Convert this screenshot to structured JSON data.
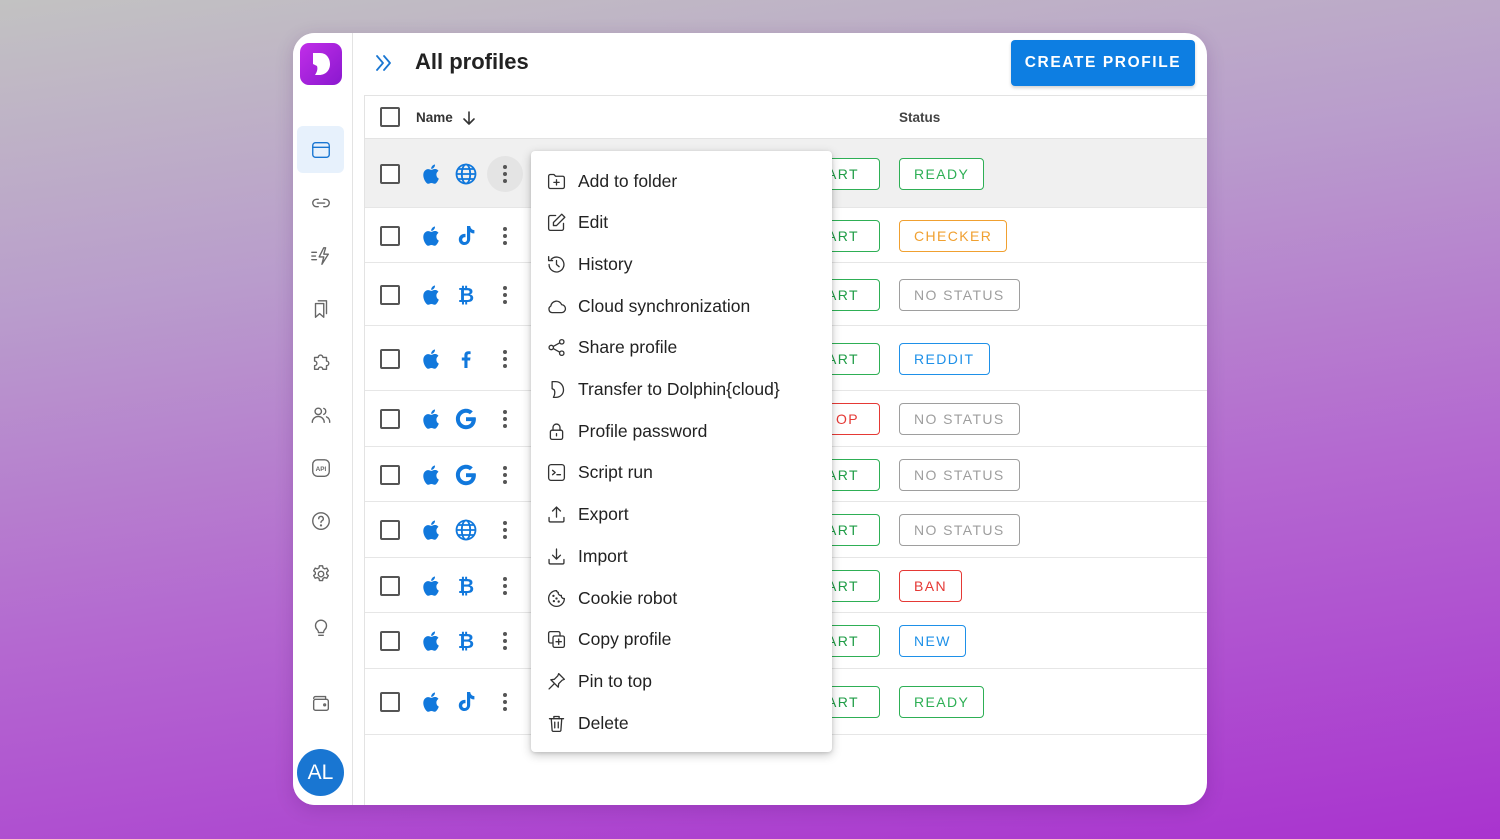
{
  "header": {
    "title": "All profiles",
    "create_label": "CREATE PROFILE"
  },
  "sidebar": {
    "avatar_initials": "AL",
    "items": [
      {
        "name": "browser-profiles",
        "icon": "browser-window-icon",
        "active": true
      },
      {
        "name": "proxies",
        "icon": "link-icon"
      },
      {
        "name": "automation",
        "icon": "lightning-icon"
      },
      {
        "name": "bookmarks",
        "icon": "bookmarks-icon"
      },
      {
        "name": "extensions",
        "icon": "puzzle-icon"
      },
      {
        "name": "team",
        "icon": "users-icon"
      },
      {
        "name": "api",
        "icon": "api-icon"
      },
      {
        "name": "help",
        "icon": "help-icon"
      },
      {
        "name": "settings",
        "icon": "gear-icon"
      },
      {
        "name": "ideas",
        "icon": "lightbulb-icon"
      },
      {
        "name": "wallet",
        "icon": "wallet-icon"
      }
    ]
  },
  "table": {
    "columns": {
      "name": "Name",
      "status": "Status"
    },
    "rows": [
      {
        "os": "apple-icon",
        "site": "globe-icon",
        "action": "ART",
        "status": "READY"
      },
      {
        "os": "apple-icon",
        "site": "tiktok-icon",
        "action": "ART",
        "status": "CHECKER"
      },
      {
        "os": "apple-icon",
        "site": "bitcoin-icon",
        "action": "ART",
        "status": "NO STATUS"
      },
      {
        "os": "apple-icon",
        "site": "facebook-icon",
        "action": "ART",
        "status": "REDDIT"
      },
      {
        "os": "apple-icon",
        "site": "google-icon",
        "action": "OP",
        "status": "NO STATUS"
      },
      {
        "os": "apple-icon",
        "site": "google-icon",
        "action": "ART",
        "status": "NO STATUS"
      },
      {
        "os": "apple-icon",
        "site": "globe-icon",
        "action": "ART",
        "status": "NO STATUS"
      },
      {
        "os": "apple-icon",
        "site": "bitcoin-icon",
        "action": "ART",
        "status": "BAN"
      },
      {
        "os": "apple-icon",
        "site": "bitcoin-icon",
        "action": "ART",
        "status": "NEW"
      },
      {
        "os": "apple-icon",
        "site": "tiktok-icon",
        "action": "ART",
        "status": "READY"
      }
    ]
  },
  "status_colors": {
    "READY": "#2eaf55",
    "CHECKER": "#f0a030",
    "NO STATUS": "#9e9e9e",
    "REDDIT": "#1e90e8",
    "BAN": "#e53935",
    "NEW": "#1e90e8"
  },
  "context_menu": {
    "items": [
      {
        "label": "Add to folder",
        "icon": "folder-plus-icon"
      },
      {
        "label": "Edit",
        "icon": "edit-icon"
      },
      {
        "label": "History",
        "icon": "history-icon"
      },
      {
        "label": "Cloud synchronization",
        "icon": "cloud-icon"
      },
      {
        "label": "Share profile",
        "icon": "share-icon"
      },
      {
        "label": "Transfer to Dolphin{cloud}",
        "icon": "dolphin-icon"
      },
      {
        "label": "Profile password",
        "icon": "lock-icon"
      },
      {
        "label": "Script run",
        "icon": "terminal-icon"
      },
      {
        "label": "Export",
        "icon": "upload-icon"
      },
      {
        "label": "Import",
        "icon": "download-icon"
      },
      {
        "label": "Cookie robot",
        "icon": "cookie-icon"
      },
      {
        "label": "Copy profile",
        "icon": "copy-icon"
      },
      {
        "label": "Pin to top",
        "icon": "pin-icon"
      },
      {
        "label": "Delete",
        "icon": "trash-icon"
      }
    ]
  }
}
